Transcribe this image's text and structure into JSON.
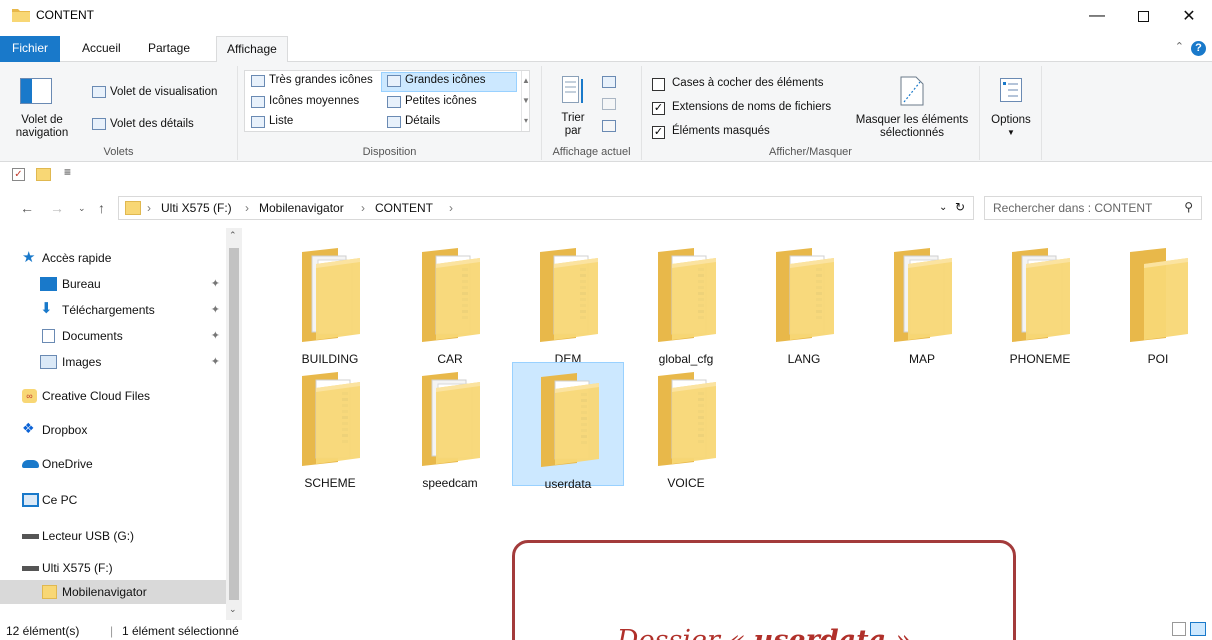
{
  "window": {
    "title": "CONTENT",
    "minimize_icon": "minimize-icon",
    "maximize_icon": "maximize-icon",
    "close_icon": "close-icon"
  },
  "tabs": [
    {
      "label": "Fichier",
      "active": false
    },
    {
      "label": "Accueil",
      "active": false
    },
    {
      "label": "Partage",
      "active": false
    },
    {
      "label": "Affichage",
      "active": true
    }
  ],
  "ribbon": {
    "volets": {
      "group_label": "Volets",
      "nav_pane": "Volet de navigation",
      "preview_pane": "Volet de visualisation",
      "details_pane": "Volet des détails"
    },
    "disposition": {
      "group_label": "Disposition",
      "items": [
        {
          "label": "Très grandes icônes",
          "selected": false
        },
        {
          "label": "Grandes icônes",
          "selected": true
        },
        {
          "label": "Icônes moyennes",
          "selected": false
        },
        {
          "label": "Petites icônes",
          "selected": false
        },
        {
          "label": "Liste",
          "selected": false
        },
        {
          "label": "Détails",
          "selected": false
        }
      ]
    },
    "affichage_actuel": {
      "group_label": "Affichage actuel",
      "sort_label": "Trier par"
    },
    "afficher_masquer": {
      "group_label": "Afficher/Masquer",
      "checkboxes": [
        {
          "label": "Cases à cocher des éléments",
          "checked": false
        },
        {
          "label": "Extensions de noms de fichiers",
          "checked": true
        },
        {
          "label": "Éléments masqués",
          "checked": true
        }
      ],
      "hide_selected": "Masquer les éléments sélectionnés"
    },
    "options": {
      "label": "Options"
    }
  },
  "address": {
    "crumbs": [
      "Ulti X575 (F:)",
      "Mobilenavigator",
      "CONTENT"
    ],
    "search_placeholder": "Rechercher dans : CONTENT"
  },
  "sidebar": {
    "items": [
      {
        "label": "Accès rapide",
        "icon": "star-icon"
      },
      {
        "label": "Bureau",
        "icon": "desktop-icon",
        "pinned": true
      },
      {
        "label": "Téléchargements",
        "icon": "download-icon",
        "pinned": true
      },
      {
        "label": "Documents",
        "icon": "documents-icon",
        "pinned": true
      },
      {
        "label": "Images",
        "icon": "images-icon",
        "pinned": true
      },
      {
        "label": "Creative Cloud Files",
        "icon": "creative-cloud-icon"
      },
      {
        "label": "Dropbox",
        "icon": "dropbox-icon"
      },
      {
        "label": "OneDrive",
        "icon": "onedrive-icon"
      },
      {
        "label": "Ce PC",
        "icon": "computer-icon"
      },
      {
        "label": "Lecteur USB (G:)",
        "icon": "drive-icon"
      },
      {
        "label": "Ulti X575 (F:)",
        "icon": "drive-icon"
      },
      {
        "label": "Mobilenavigator",
        "icon": "folder-icon",
        "selected": true
      }
    ]
  },
  "folders": [
    {
      "name": "BUILDING",
      "style": "docs"
    },
    {
      "name": "CAR",
      "style": "files"
    },
    {
      "name": "DEM",
      "style": "files"
    },
    {
      "name": "global_cfg",
      "style": "files"
    },
    {
      "name": "LANG",
      "style": "files"
    },
    {
      "name": "MAP",
      "style": "docs"
    },
    {
      "name": "PHONEME",
      "style": "docs"
    },
    {
      "name": "POI",
      "style": "empty"
    },
    {
      "name": "SCHEME",
      "style": "files"
    },
    {
      "name": "speedcam",
      "style": "docs"
    },
    {
      "name": "userdata",
      "style": "files",
      "selected": true
    },
    {
      "name": "VOICE",
      "style": "files"
    }
  ],
  "status": {
    "count": "12 élément(s)",
    "selection": "1 élément sélectionné"
  },
  "callout": {
    "prefix": "Dossier « ",
    "folder": "userdata",
    "suffix": " »"
  },
  "colors": {
    "accent": "#1979ca",
    "folder": "#f8d775",
    "callout_border": "#a33b3b",
    "callout_text": "#b0302a"
  }
}
